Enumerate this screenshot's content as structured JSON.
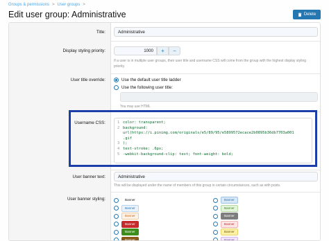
{
  "breadcrumb": {
    "items": [
      "Groups & permissions",
      "User groups"
    ],
    "separator": ">"
  },
  "page": {
    "title": "Edit user group: Administrative"
  },
  "toolbar": {
    "delete_label": "Delete"
  },
  "form": {
    "title": {
      "label": "Title:",
      "value": "Administrative"
    },
    "priority": {
      "label": "Display styling priority:",
      "value": "1000",
      "plus": "+",
      "minus": "−",
      "hint": "If a user is in multiple user groups, their user title and username CSS will come from the group with the highest display styling priority."
    },
    "title_override": {
      "label": "User title override:",
      "options": [
        "Use the default user title ladder",
        "Use the following user title:"
      ],
      "selected": 0,
      "hint": "You may use HTML"
    },
    "username_css": {
      "label": "Username CSS:",
      "lines": [
        {
          "n": "1",
          "t": "color: transparent;"
        },
        {
          "n": "2",
          "t": "background:"
        },
        {
          "n": "",
          "t": "url(https://i.pinimg.com/originals/e5/89/95/e5899572ecace2b0895b36db7703a001"
        },
        {
          "n": "",
          "t": ".gif"
        },
        {
          "n": "3",
          "t": ");"
        },
        {
          "n": "4",
          "t": "text-stroke: .6px;"
        },
        {
          "n": "5",
          "t": "-webkit-background-clip: text; font-weight: bold;"
        }
      ]
    },
    "banner_text": {
      "label": "User banner text:",
      "value": "Administrative",
      "hint": "This will be displayed under the name of members of this group in certain circumstances, such as with posts."
    },
    "banner_styling": {
      "label": "User banner styling:",
      "left": [
        {
          "text": "Banner",
          "bg": "#ffffff",
          "fg": "#141414",
          "border": "#ffffff"
        },
        {
          "text": "Banner",
          "bg": "#eaf3fb",
          "fg": "#2577b1",
          "border": "#b8d4ec"
        },
        {
          "text": "Banner",
          "bg": "#fdf2e7",
          "fg": "#c66b16",
          "border": "#f0c9a0"
        },
        {
          "text": "Banner",
          "bg": "#c62a2a",
          "fg": "#ffffff",
          "border": "#c62a2a"
        },
        {
          "text": "Banner",
          "bg": "#3d8d1a",
          "fg": "#ffffff",
          "border": "#3d8d1a"
        },
        {
          "text": "Banner",
          "bg": "#8a5a19",
          "fg": "#ffffff",
          "border": "#8a5a19"
        }
      ],
      "right": [
        {
          "text": "Banner",
          "bg": "#d9e8f7",
          "fg": "#2577b1",
          "border": "#9fc2e3"
        },
        {
          "text": "Banner",
          "bg": "#e4f3dc",
          "fg": "#3d8d1a",
          "border": "#b5d9a3"
        },
        {
          "text": "Banner",
          "bg": "#7d7d7d",
          "fg": "#ffffff",
          "border": "#7d7d7d"
        },
        {
          "text": "Banner",
          "bg": "#fde6e6",
          "fg": "#c62a2a",
          "border": "#f1b2b2"
        },
        {
          "text": "Banner",
          "bg": "#fff1a8",
          "fg": "#6b5a00",
          "border": "#e7d36a"
        },
        {
          "text": "Banner",
          "bg": "#f2e6fb",
          "fg": "#7a3ca8",
          "border": "#d3b4ea"
        }
      ]
    }
  },
  "colors": {
    "accent": "#2577b1",
    "highlight": "#1b3ea8",
    "link": "#47a7eb"
  },
  "icons": {
    "delete": "trash-icon"
  }
}
